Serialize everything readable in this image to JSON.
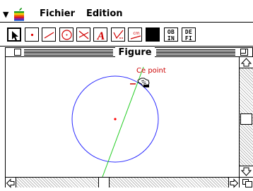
{
  "menubar": {
    "menus": [
      "Fichier",
      "Edition"
    ]
  },
  "toolbar": {
    "tools": [
      {
        "name": "pointer-tool",
        "icon": "arrow-pointer-icon",
        "selected": true
      },
      {
        "name": "point-tool",
        "icon": "red-point-icon"
      },
      {
        "name": "segment-tool",
        "icon": "segment-icon"
      },
      {
        "name": "circle-tool",
        "icon": "circle-icon"
      },
      {
        "name": "intersection-tool",
        "icon": "intersecting-lines-icon"
      },
      {
        "name": "text-tool",
        "icon": "letter-a-icon",
        "label": "A"
      },
      {
        "name": "check-tool",
        "icon": "checkmark-icon"
      },
      {
        "name": "measure-tool",
        "icon": "measure-cm-icon",
        "label": "cm"
      },
      {
        "name": "color-tool",
        "icon": "black-square-icon"
      },
      {
        "name": "ob-in-tool",
        "label_top": "OB",
        "label_bottom": "IN"
      },
      {
        "name": "de-fi-tool",
        "label_top": "DE",
        "label_bottom": "FI"
      }
    ]
  },
  "window": {
    "title": "Figure"
  },
  "figure": {
    "tooltip": "Ce point",
    "colors": {
      "circle": "#2a2aff",
      "line": "#22cc22",
      "center": "#ff0000",
      "tooltip": "#cc0000"
    }
  }
}
